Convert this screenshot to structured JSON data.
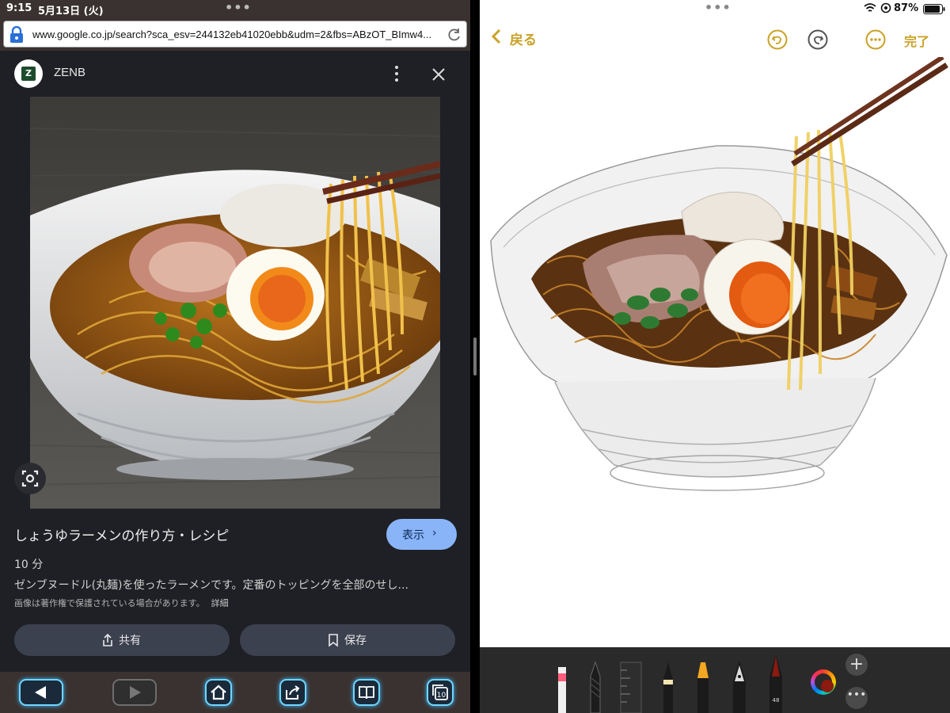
{
  "status_left": {
    "time": "9:15",
    "date": "5月13日 (火)"
  },
  "browser": {
    "url": "www.google.co.jp/search?sca_esv=244132eb41020ebb&udm=2&fbs=ABzOT_BImw4..."
  },
  "site": {
    "logo_letter": "Z",
    "name": "ZENB"
  },
  "result": {
    "title": "しょうゆラーメンの作り方・レシピ",
    "show_label": "表示",
    "time": "10 分",
    "description": "ゼンブヌードル(丸麺)を使ったラーメンです。定番のトッピングを全部のせし...",
    "copyright": "画像は著作権で保護されている場合があります。",
    "copyright_detail": "詳細",
    "share_label": "共有",
    "save_label": "保存"
  },
  "bottom_nav": {
    "items": [
      {
        "icon": "back-triangle-icon",
        "enabled": true
      },
      {
        "icon": "forward-triangle-icon",
        "enabled": false
      },
      {
        "icon": "home-icon",
        "enabled": true
      },
      {
        "icon": "share-icon",
        "enabled": true
      },
      {
        "icon": "book-icon",
        "enabled": true
      },
      {
        "icon": "tabs-icon",
        "badge": "10",
        "enabled": true
      }
    ]
  },
  "status_right": {
    "battery": "87%"
  },
  "notes": {
    "back_label": "戻る",
    "done_label": "完了"
  },
  "pencil_tray": {
    "marker_size_label": "48",
    "selected_color": "#8b1a10"
  },
  "colors": {
    "accent_gold": "#c9a227",
    "link_blue": "#8ab4f8",
    "dark_bg": "#1f2025",
    "nav_glow": "#6fd6ff"
  }
}
